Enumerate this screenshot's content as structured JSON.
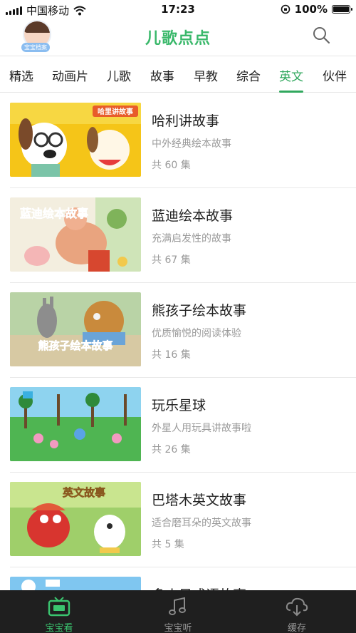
{
  "status_bar": {
    "carrier": "中国移动",
    "time": "17:23",
    "battery": "100%",
    "battery_level": 1.0
  },
  "header": {
    "avatar_tag": "宝宝档案",
    "logo": "儿歌点点",
    "search_icon": "search-icon"
  },
  "tabs": [
    {
      "label": "精选"
    },
    {
      "label": "动画片"
    },
    {
      "label": "儿歌"
    },
    {
      "label": "故事"
    },
    {
      "label": "早教"
    },
    {
      "label": "综合"
    },
    {
      "label": "英文",
      "active": true
    },
    {
      "label": "伙伴"
    }
  ],
  "items": [
    {
      "thumb_text": "哈里讲故事",
      "title": "哈利讲故事",
      "desc": "中外经典绘本故事",
      "count": "共 60 集"
    },
    {
      "thumb_text": "蓝迪绘本故事",
      "title": "蓝迪绘本故事",
      "desc": "充满启发性的故事",
      "count": "共 67 集"
    },
    {
      "thumb_text": "熊孩子绘本故事",
      "title": "熊孩子绘本故事",
      "desc": "优质愉悦的阅读体验",
      "count": "共 16 集"
    },
    {
      "thumb_text": "",
      "title": "玩乐星球",
      "desc": "外星人用玩具讲故事啦",
      "count": "共 26 集"
    },
    {
      "thumb_text": "英文故事",
      "title": "巴塔木英文故事",
      "desc": "适合磨耳朵的英文故事",
      "count": "共 5 集"
    },
    {
      "thumb_text": "",
      "title": "多小贝成语故事",
      "desc": "",
      "count": ""
    }
  ],
  "bottom_nav": [
    {
      "label": "宝宝看",
      "icon": "tv-icon",
      "active": true
    },
    {
      "label": "宝宝听",
      "icon": "music-note-icon"
    },
    {
      "label": "缓存",
      "icon": "cloud-download-icon"
    }
  ],
  "colors": {
    "accent": "#31a85e",
    "nav_bg": "#1f1f1f",
    "muted_text": "#9a9a9a"
  }
}
